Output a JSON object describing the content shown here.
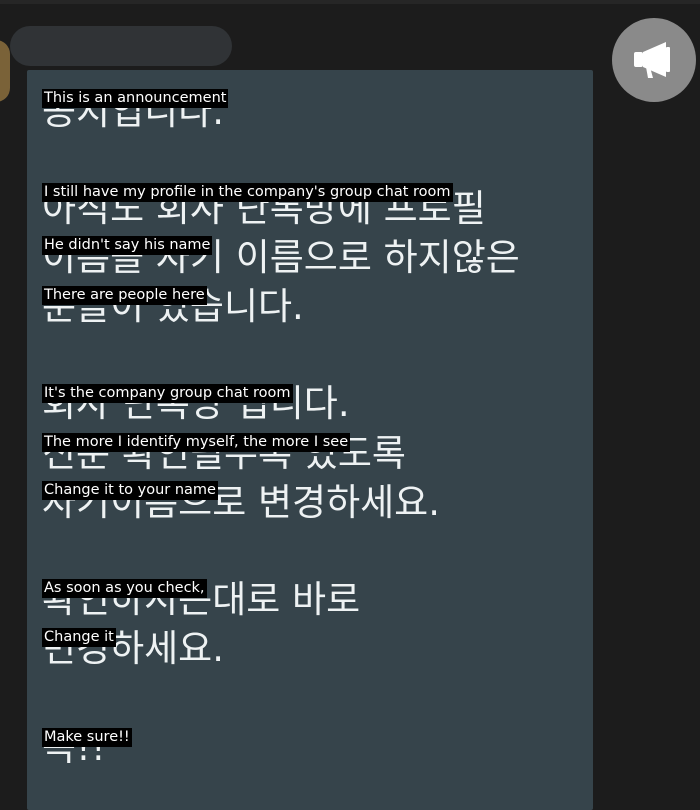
{
  "chat": {
    "announcement_button": {
      "icon": "megaphone-icon"
    },
    "message": {
      "korean_lines": [
        "공지입니다.",
        "아직도 회사 단톡방에 프로필",
        "이름을 자기 이름으로 하지않은",
        "분들이 있습니다.",
        "회사 단톡방 입니다.",
        "신분 확인될수록 있도록",
        "자기이름으로 변경하세요.",
        "확인하시는대로 바로",
        "변경하세요.",
        "꼭!!"
      ],
      "translations": [
        "This is an announcement",
        "I still have my profile in the company's group chat room",
        "He didn't say his name",
        "There are people here",
        "It's the company group chat room",
        "The more I identify myself, the more I see",
        "Change it to your name",
        "As soon as you check,",
        "Change it",
        "Make sure!!"
      ]
    }
  },
  "colors": {
    "background": "#1c1c1c",
    "bubble": "#36444b",
    "name_pill": "#303336",
    "announcement_button": "#8a8a8a",
    "caption_bg": "#000000",
    "text": "#eef2f3"
  }
}
